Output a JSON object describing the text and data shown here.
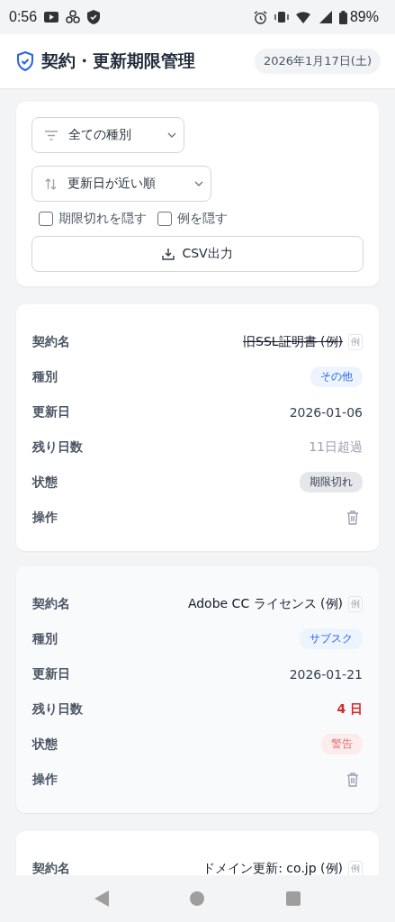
{
  "status_bar": {
    "time": "0:56",
    "battery": "89%"
  },
  "header": {
    "title": "契約・更新期限管理",
    "date": "2026年1月17日(土)"
  },
  "filters": {
    "type_select": {
      "value": "全ての種別"
    },
    "sort_select": {
      "value": "更新日が近い順"
    },
    "checkboxes": [
      {
        "label": "期限切れを隠す",
        "checked": false
      },
      {
        "label": "例を隠す",
        "checked": false
      }
    ],
    "export_button": "CSV出力"
  },
  "cards": [
    {
      "highlighted": false,
      "rows": [
        {
          "kind": "name",
          "label": "契約名",
          "value": "旧SSL証明書 (例)",
          "struck": true,
          "tag": "例"
        },
        {
          "kind": "type",
          "label": "種別",
          "value": "その他"
        },
        {
          "kind": "text",
          "label": "更新日",
          "value": "2026-01-06"
        },
        {
          "kind": "days",
          "label": "残り日数",
          "value": "11日超過",
          "urgent": false
        },
        {
          "kind": "status",
          "label": "状態",
          "value": "期限切れ",
          "expired": true
        },
        {
          "kind": "action",
          "label": "操作"
        }
      ]
    },
    {
      "highlighted": true,
      "rows": [
        {
          "kind": "name",
          "label": "契約名",
          "value": "Adobe CC ライセンス (例)",
          "struck": false,
          "tag": "例"
        },
        {
          "kind": "type",
          "label": "種別",
          "value": "サブスク"
        },
        {
          "kind": "text",
          "label": "更新日",
          "value": "2026-01-21"
        },
        {
          "kind": "days",
          "label": "残り日数",
          "value": "4 日",
          "urgent": true
        },
        {
          "kind": "status",
          "label": "状態",
          "value": "警告",
          "expired": false
        },
        {
          "kind": "action",
          "label": "操作"
        }
      ]
    },
    {
      "highlighted": false,
      "rows": [
        {
          "kind": "name",
          "label": "契約名",
          "value": "ドメイン更新: co.jp (例)",
          "struck": false,
          "tag": "例"
        }
      ]
    }
  ]
}
